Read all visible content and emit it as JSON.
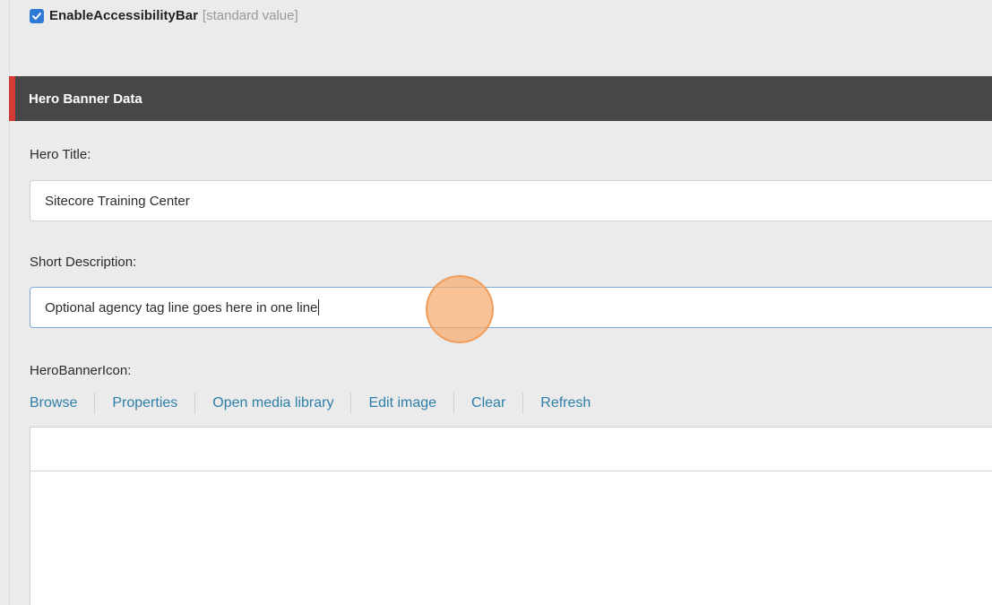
{
  "checkbox": {
    "label": "EnableAccessibilityBar",
    "suffix": "[standard value]",
    "checked": true,
    "color": "#2f7ad5"
  },
  "section": {
    "title": "Hero Banner Data",
    "accent_color": "#d23a35",
    "header_color": "#474747"
  },
  "fields": {
    "hero_title": {
      "label": "Hero Title:",
      "value": "Sitecore Training Center"
    },
    "short_description": {
      "label": "Short Description:",
      "value": "Optional agency tag line goes here in one line"
    },
    "hero_banner_icon": {
      "label": "HeroBannerIcon:"
    }
  },
  "toolbar": {
    "browse": "Browse",
    "properties": "Properties",
    "open_media_library": "Open media library",
    "edit_image": "Edit image",
    "clear": "Clear",
    "refresh": "Refresh",
    "link_color": "#2d7fa8"
  },
  "icons": {
    "checkmark": "checkmark-icon"
  }
}
